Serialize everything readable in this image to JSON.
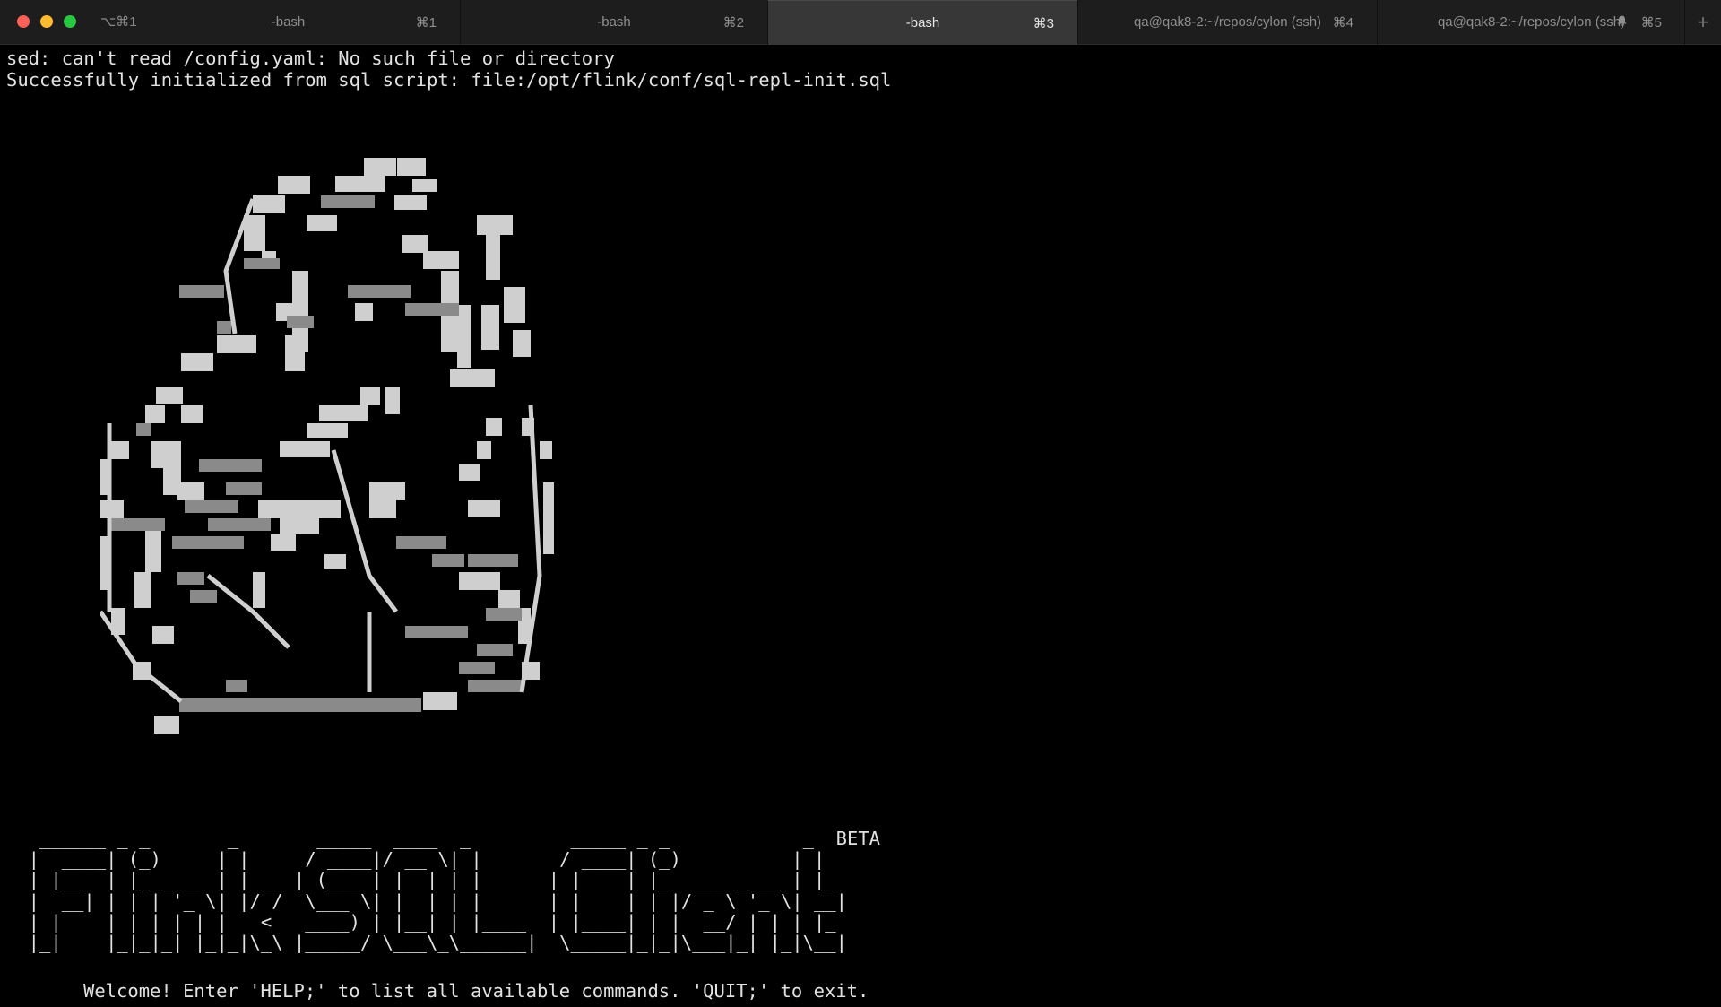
{
  "window": {
    "shortcut": "⌥⌘1",
    "traffic_colors": {
      "close": "#fe5f57",
      "minimize": "#febc2e",
      "maximize": "#28c840"
    }
  },
  "tabs": [
    {
      "title": "-bash",
      "shortcut": "⌘1",
      "active": false
    },
    {
      "title": "-bash",
      "shortcut": "⌘2",
      "active": false
    },
    {
      "title": "-bash",
      "shortcut": "⌘3",
      "active": true
    },
    {
      "title": "qa@qak8-2:~/repos/cylon (ssh)",
      "shortcut": "⌘4",
      "active": false
    },
    {
      "title": "qa@qak8-2:~/repos/cylon (ssh)",
      "shortcut": "⌘5",
      "active": false,
      "icon": "bell-icon"
    }
  ],
  "new_tab_label": "+",
  "terminal": {
    "lines": [
      "sed: can't read /config.yaml: No such file or directory",
      "Successfully initialized from sql script: file:/opt/flink/conf/sql-repl-init.sql"
    ],
    "art_icon": "flink-squirrel-ascii-art",
    "banner": "   ______ _ _       _       _____  ____  _         _____ _ _            _  BETA\n  |  ____| (_)     | |     / ____|/ __ \\| |       / ____| (_)          | |\n  | |__  | |_ _ __ | | __ | (___ | |  | | |      | |    | |_  ___ _ __ | |_\n  |  __| | | | '_ \\| |/ /  \\___ \\| |  | | |      | |    | | |/ _ \\ '_ \\| __|\n  | |    | | | | | |   <   ____) | |__| | |____  | |____| | |  __/ | | | |_\n  |_|    |_|_|_| |_|_|\\_\\ |_____/ \\___\\_\\______|  \\_____|_|_|\\___|_| |_|\\__|",
    "welcome": "Welcome! Enter 'HELP;' to list all available commands. 'QUIT;' to exit."
  }
}
